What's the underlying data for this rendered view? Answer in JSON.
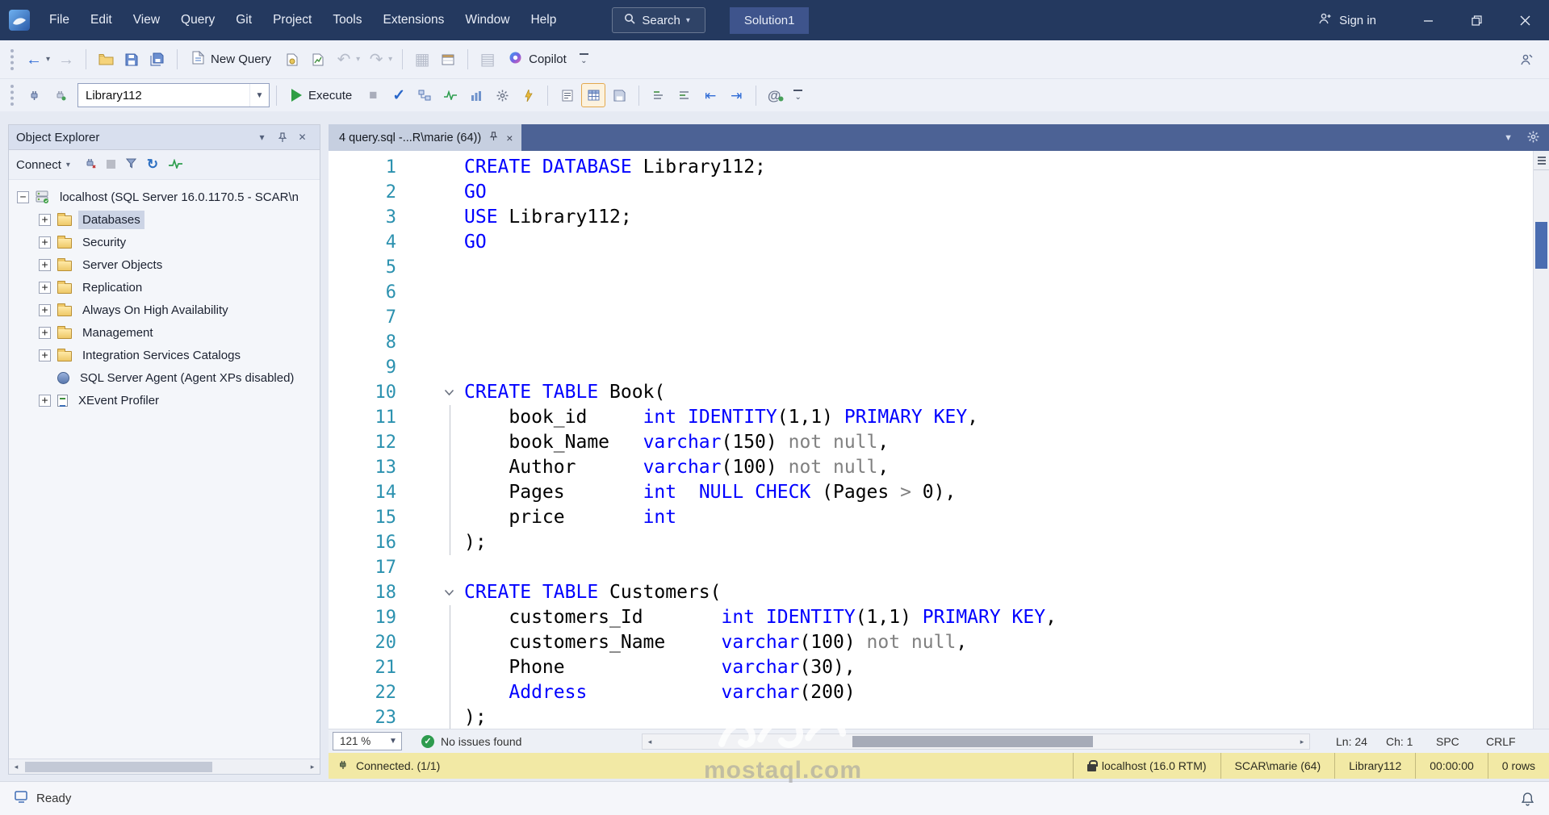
{
  "titlebar": {
    "menus": [
      "File",
      "Edit",
      "View",
      "Query",
      "Git",
      "Project",
      "Tools",
      "Extensions",
      "Window",
      "Help"
    ],
    "search": "Search",
    "solution": "Solution1",
    "sign_in": "Sign in"
  },
  "toolbar1": {
    "new_query": "New Query",
    "copilot": "Copilot"
  },
  "toolbar2": {
    "database": "Library112",
    "execute": "Execute"
  },
  "object_explorer": {
    "title": "Object Explorer",
    "connect": "Connect",
    "root": "localhost (SQL Server 16.0.1170.5 - SCAR\\n",
    "items": [
      {
        "label": "Databases",
        "selected": true,
        "expand": "plus",
        "icon": "folder"
      },
      {
        "label": "Security",
        "expand": "plus",
        "icon": "folder"
      },
      {
        "label": "Server Objects",
        "expand": "plus",
        "icon": "folder"
      },
      {
        "label": "Replication",
        "expand": "plus",
        "icon": "folder"
      },
      {
        "label": "Always On High Availability",
        "expand": "plus",
        "icon": "folder"
      },
      {
        "label": "Management",
        "expand": "plus",
        "icon": "folder"
      },
      {
        "label": "Integration Services Catalogs",
        "expand": "plus",
        "icon": "folder"
      },
      {
        "label": "SQL Server Agent (Agent XPs disabled)",
        "expand": "none",
        "icon": "agent"
      },
      {
        "label": "XEvent Profiler",
        "expand": "plus",
        "icon": "xevent"
      }
    ]
  },
  "editor": {
    "tab": "4 query.sql -...R\\marie (64))",
    "zoom": "121 %",
    "issues": "No issues found",
    "ln": "Ln: 24",
    "ch": "Ch: 1",
    "spc": "SPC",
    "eol": "CRLF",
    "colors": {
      "keyword": "#0000ff",
      "plain": "#000000",
      "muted": "#808080",
      "line_number": "#2b91af"
    },
    "lines": [
      {
        "n": 1,
        "tokens": [
          [
            "k",
            "CREATE DATABASE"
          ],
          [
            "p",
            " Library112;"
          ]
        ]
      },
      {
        "n": 2,
        "tokens": [
          [
            "k",
            "GO"
          ]
        ]
      },
      {
        "n": 3,
        "tokens": [
          [
            "k",
            "USE"
          ],
          [
            "p",
            " Library112;"
          ]
        ]
      },
      {
        "n": 4,
        "tokens": [
          [
            "k",
            "GO"
          ]
        ]
      },
      {
        "n": 5,
        "tokens": []
      },
      {
        "n": 6,
        "tokens": []
      },
      {
        "n": 7,
        "tokens": []
      },
      {
        "n": 8,
        "tokens": []
      },
      {
        "n": 9,
        "tokens": []
      },
      {
        "n": 10,
        "fold": true,
        "tokens": [
          [
            "k",
            "CREATE TABLE"
          ],
          [
            "p",
            " Book("
          ]
        ]
      },
      {
        "n": 11,
        "g": true,
        "tokens": [
          [
            "p",
            "    book_id     "
          ],
          [
            "k",
            "int"
          ],
          [
            "p",
            " "
          ],
          [
            "k",
            "IDENTITY"
          ],
          [
            "p",
            "(1,1) "
          ],
          [
            "k",
            "PRIMARY KEY"
          ],
          [
            "p",
            ","
          ]
        ]
      },
      {
        "n": 12,
        "g": true,
        "tokens": [
          [
            "p",
            "    book_Name   "
          ],
          [
            "k",
            "varchar"
          ],
          [
            "p",
            "(150) "
          ],
          [
            "m",
            "not null"
          ],
          [
            "p",
            ","
          ]
        ]
      },
      {
        "n": 13,
        "g": true,
        "tokens": [
          [
            "p",
            "    Author      "
          ],
          [
            "k",
            "varchar"
          ],
          [
            "p",
            "(100) "
          ],
          [
            "m",
            "not null"
          ],
          [
            "p",
            ","
          ]
        ]
      },
      {
        "n": 14,
        "g": true,
        "tokens": [
          [
            "p",
            "    Pages       "
          ],
          [
            "k",
            "int"
          ],
          [
            "p",
            "  "
          ],
          [
            "k",
            "NULL"
          ],
          [
            "p",
            " "
          ],
          [
            "k",
            "CHECK"
          ],
          [
            "p",
            " (Pages "
          ],
          [
            "m",
            ">"
          ],
          [
            "p",
            " 0),"
          ]
        ]
      },
      {
        "n": 15,
        "g": true,
        "tokens": [
          [
            "p",
            "    price       "
          ],
          [
            "k",
            "int"
          ]
        ]
      },
      {
        "n": 16,
        "g": true,
        "tokens": [
          [
            "p",
            ");"
          ]
        ]
      },
      {
        "n": 17,
        "tokens": []
      },
      {
        "n": 18,
        "fold": true,
        "tokens": [
          [
            "k",
            "CREATE TABLE"
          ],
          [
            "p",
            " Customers("
          ]
        ]
      },
      {
        "n": 19,
        "g": true,
        "tokens": [
          [
            "p",
            "    customers_Id       "
          ],
          [
            "k",
            "int"
          ],
          [
            "p",
            " "
          ],
          [
            "k",
            "IDENTITY"
          ],
          [
            "p",
            "(1,1) "
          ],
          [
            "k",
            "PRIMARY KEY"
          ],
          [
            "p",
            ","
          ]
        ]
      },
      {
        "n": 20,
        "g": true,
        "tokens": [
          [
            "p",
            "    customers_Name     "
          ],
          [
            "k",
            "varchar"
          ],
          [
            "p",
            "(100) "
          ],
          [
            "m",
            "not null"
          ],
          [
            "p",
            ","
          ]
        ]
      },
      {
        "n": 21,
        "g": true,
        "tokens": [
          [
            "p",
            "    Phone              "
          ],
          [
            "k",
            "varchar"
          ],
          [
            "p",
            "(30),"
          ]
        ]
      },
      {
        "n": 22,
        "g": true,
        "tokens": [
          [
            "p",
            "    "
          ],
          [
            "k",
            "Address"
          ],
          [
            "p",
            "            "
          ],
          [
            "k",
            "varchar"
          ],
          [
            "p",
            "(200)"
          ]
        ]
      },
      {
        "n": 23,
        "g": true,
        "tokens": [
          [
            "p",
            ");"
          ]
        ]
      }
    ]
  },
  "connection_bar": {
    "connected": "Connected. (1/1)",
    "segments": [
      "localhost (16.0 RTM)",
      "SCAR\\marie (64)",
      "Library112",
      "00:00:00",
      "0 rows"
    ]
  },
  "status": {
    "ready": "Ready"
  },
  "watermark": {
    "logo_text": "مستقل",
    "domain": "mostaql.com"
  }
}
